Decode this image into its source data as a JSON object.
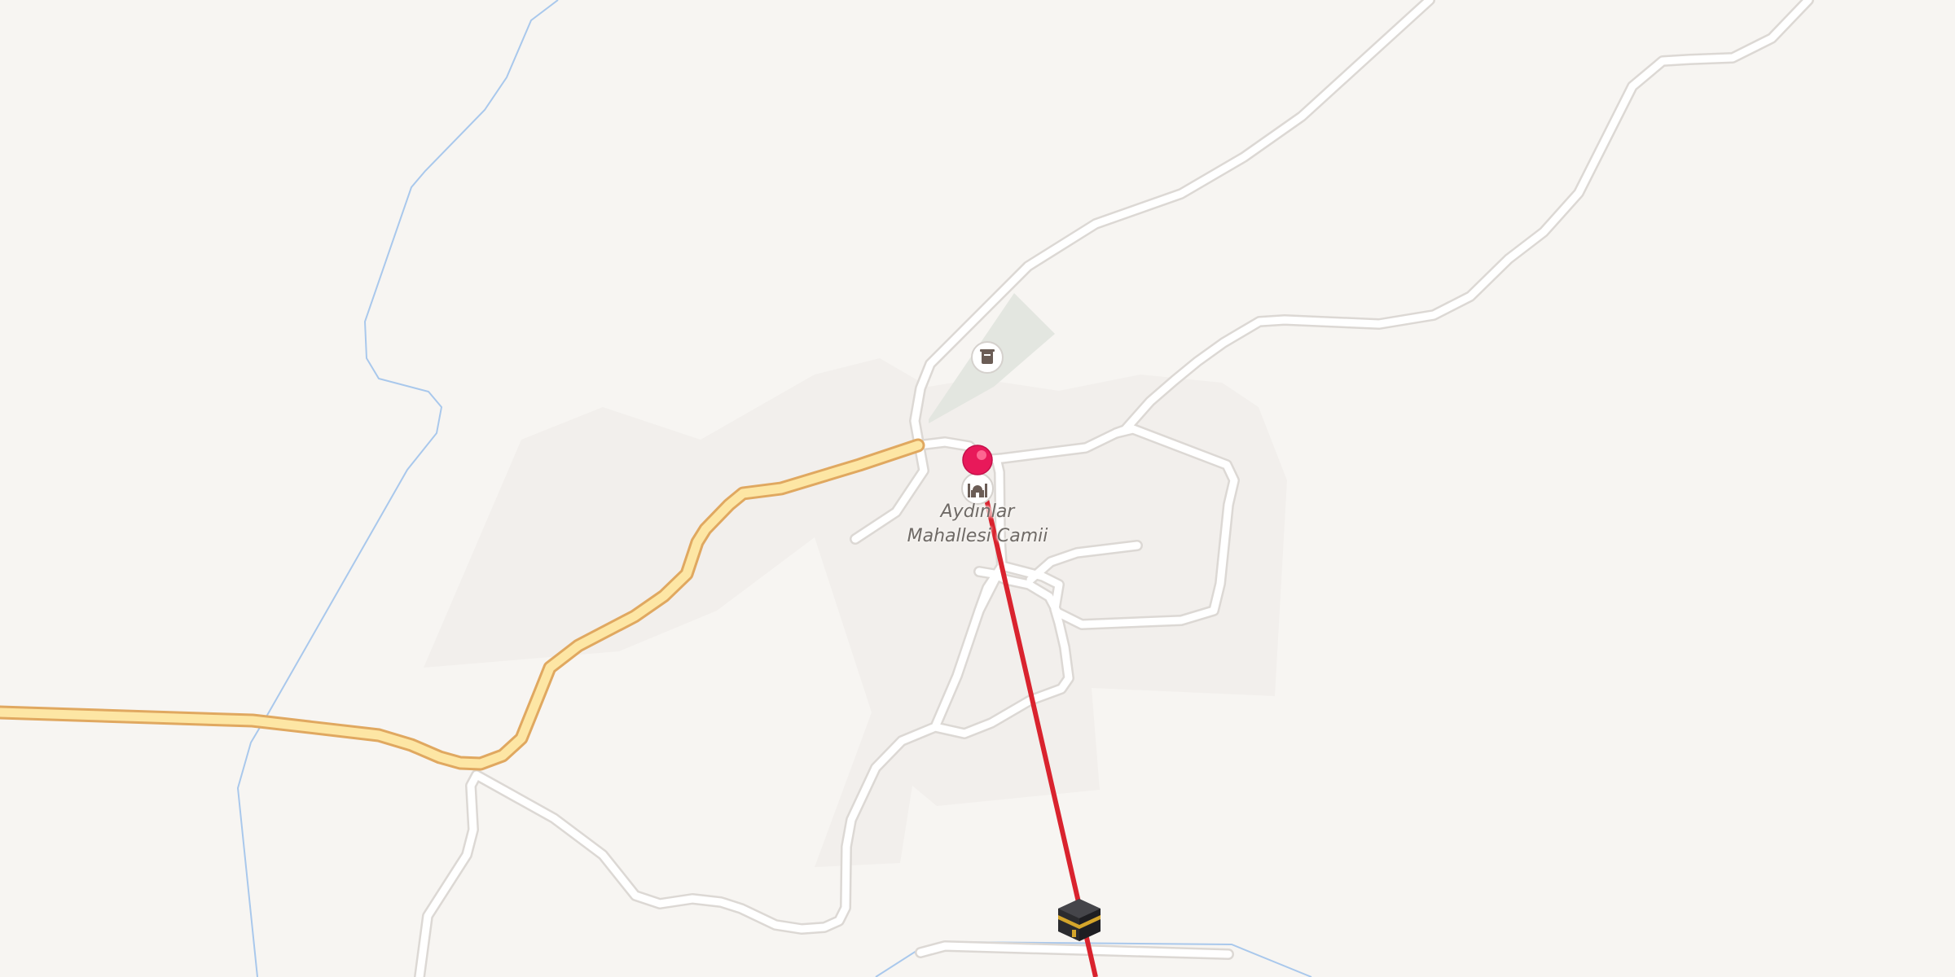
{
  "map": {
    "place_label_line1": "Aydınlar",
    "place_label_line2": "Mahallesi Camii",
    "colors": {
      "land": "#f7f5f2",
      "residential": "#f2efec",
      "cemetery": "#e3e6e0",
      "road_fill": "#ffffff",
      "road_casing": "#dcd8d4",
      "primary_fill": "#fde6a4",
      "primary_casing": "#e0a860",
      "waterway": "#a9c8ec",
      "qibla_line": "#d9232e",
      "pin": "#e8195a"
    },
    "icons": {
      "mosque": "mosque-icon",
      "cemetery": "cemetery-icon",
      "pin": "location-pin-icon",
      "kaaba": "kaaba-icon"
    }
  }
}
